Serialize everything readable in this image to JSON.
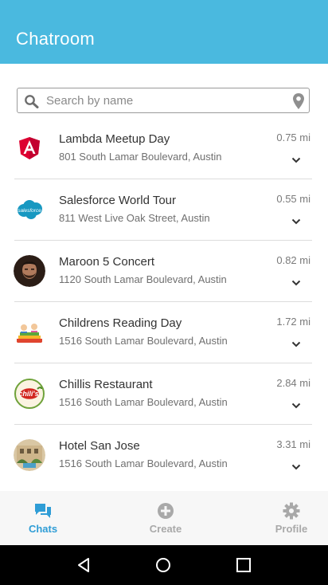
{
  "header": {
    "title": "Chatroom",
    "color": "#4ab9df"
  },
  "search": {
    "placeholder": "Search by name",
    "value": ""
  },
  "events": [
    {
      "name": "Lambda Meetup Day",
      "address": "801 South Lamar Boulevard, Austin",
      "distance": "0.75 mi",
      "avatar": "angular-logo"
    },
    {
      "name": "Salesforce World Tour",
      "address": "811 West Live Oak Street, Austin",
      "distance": "0.55 mi",
      "avatar": "salesforce-logo"
    },
    {
      "name": "Maroon 5 Concert",
      "address": "1120 South Lamar Boulevard, Austin",
      "distance": "0.82 mi",
      "avatar": "person-photo"
    },
    {
      "name": "Childrens Reading Day",
      "address": "1516 South Lamar Boulevard, Austin",
      "distance": "1.72 mi",
      "avatar": "kids-reading-illustration"
    },
    {
      "name": "Chillis Restaurant",
      "address": "1516 South Lamar Boulevard, Austin",
      "distance": "2.84 mi",
      "avatar": "chilis-logo"
    },
    {
      "name": "Hotel San Jose",
      "address": "1516 South Lamar Boulevard, Austin",
      "distance": "3.31 mi",
      "avatar": "hotel-photo"
    }
  ],
  "bottom_nav": [
    {
      "label": "Chats",
      "icon": "chat-bubbles-icon",
      "active": true
    },
    {
      "label": "Create",
      "icon": "plus-circle-icon",
      "active": false
    },
    {
      "label": "Profile",
      "icon": "gear-icon",
      "active": false
    }
  ],
  "system_nav": [
    "back-icon",
    "home-icon",
    "recents-icon"
  ]
}
